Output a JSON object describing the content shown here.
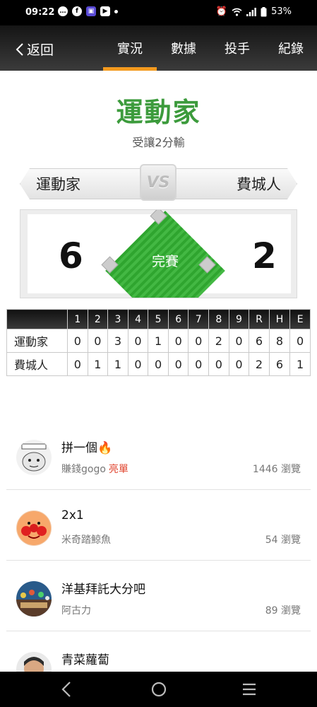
{
  "status_bar": {
    "time": "09:22",
    "battery": "53%",
    "left_icons": [
      "chat-icon",
      "facebook-icon",
      "app-icon",
      "youtube-icon",
      "dot-icon"
    ],
    "right_icons": [
      "alarm-icon",
      "wifi-icon",
      "signal-icon",
      "battery-icon"
    ]
  },
  "header": {
    "back_label": "返回",
    "tabs": [
      {
        "label": "實況",
        "active": true
      },
      {
        "label": "數據",
        "active": false
      },
      {
        "label": "投手",
        "active": false
      },
      {
        "label": "紀錄",
        "active": false
      }
    ],
    "accent_color": "#f39a1f"
  },
  "game": {
    "winner": "運動家",
    "margin_text": "受讓2分輸",
    "vs_label": "VS",
    "away_team": "運動家",
    "home_team": "費城人",
    "away_score": "6",
    "home_score": "2",
    "status": "完賽",
    "winner_color": "#3c9b3c"
  },
  "linescore": {
    "headers": [
      "1",
      "2",
      "3",
      "4",
      "5",
      "6",
      "7",
      "8",
      "9",
      "R",
      "H",
      "E"
    ],
    "rows": [
      {
        "team": "運動家",
        "cells": [
          "0",
          "0",
          "3",
          "0",
          "1",
          "0",
          "0",
          "2",
          "0",
          "6",
          "8",
          "0"
        ]
      },
      {
        "team": "費城人",
        "cells": [
          "0",
          "1",
          "1",
          "0",
          "0",
          "0",
          "0",
          "0",
          "0",
          "2",
          "6",
          "1"
        ]
      }
    ]
  },
  "posts": [
    {
      "title": "拼一個🔥",
      "author": "賺錢gogo",
      "tag": "亮單",
      "views": "1446 瀏覽",
      "avatar": "meme-face-avatar"
    },
    {
      "title": "2x1",
      "author": "米奇踏鯨魚",
      "tag": "",
      "views": "54 瀏覽",
      "avatar": "cartoon-face-avatar"
    },
    {
      "title": "洋基拜託大分吧",
      "author": "阿古力",
      "tag": "",
      "views": "89 瀏覽",
      "avatar": "crowd-photo-avatar"
    },
    {
      "title": "青菜蘿蔔",
      "author": "",
      "tag": "",
      "views": "",
      "avatar": "person-photo-avatar"
    }
  ],
  "nav": {
    "buttons": [
      "back-nav-icon",
      "home-nav-icon",
      "recents-nav-icon"
    ]
  }
}
